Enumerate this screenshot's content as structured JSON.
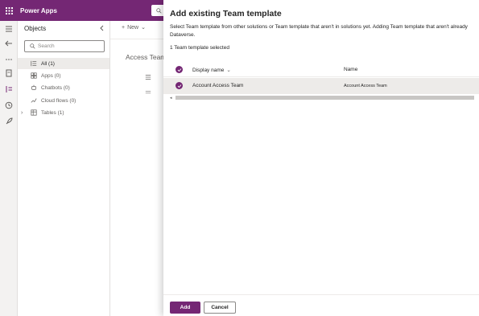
{
  "header": {
    "app_name": "Power Apps"
  },
  "objects_panel": {
    "title": "Objects",
    "search_placeholder": "Search",
    "items": [
      {
        "label": "All  (1)",
        "icon": "list-icon"
      },
      {
        "label": "Apps  (0)",
        "icon": "apps-icon"
      },
      {
        "label": "Chatbots  (0)",
        "icon": "chatbot-icon"
      },
      {
        "label": "Cloud flows  (0)",
        "icon": "flow-icon"
      },
      {
        "label": "Tables  (1)",
        "icon": "table-icon"
      }
    ]
  },
  "main": {
    "new_label": "New",
    "title": "Access Team"
  },
  "dialog": {
    "title": "Add existing Team template",
    "description": "Select Team template from other solutions or Team template that aren't in solutions yet. Adding Team template that aren't already Dataverse.",
    "selected_count": "1 Team template selected",
    "columns": {
      "display_name": "Display name",
      "name": "Name"
    },
    "rows": [
      {
        "display_name": "Account Access Team",
        "name": "Account Access Team",
        "selected": true
      }
    ],
    "add_label": "Add",
    "cancel_label": "Cancel"
  },
  "colors": {
    "brand": "#742774",
    "row_selected": "#edebe9"
  }
}
